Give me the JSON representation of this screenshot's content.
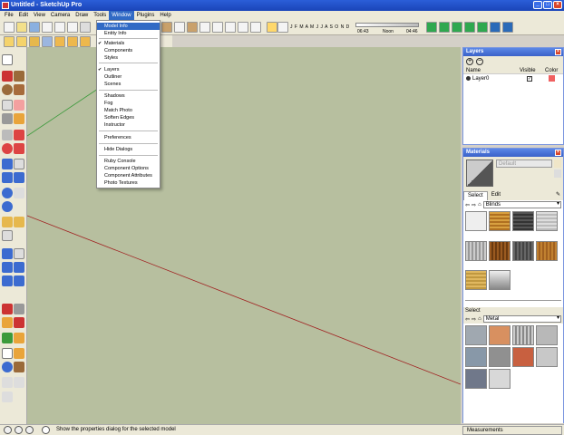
{
  "window": {
    "title": "Untitled - SketchUp Pro"
  },
  "menu": [
    "File",
    "Edit",
    "View",
    "Camera",
    "Draw",
    "Tools",
    "Window",
    "Plugins",
    "Help"
  ],
  "window_menu": {
    "items": [
      {
        "label": "Model Info",
        "selected": true
      },
      {
        "label": "Entity Info"
      },
      {
        "label": "Materials",
        "checked": true
      },
      {
        "label": "Components"
      },
      {
        "label": "Styles"
      },
      {
        "label": "Layers",
        "checked": true
      },
      {
        "label": "Outliner"
      },
      {
        "label": "Scenes"
      },
      {
        "label": "Shadows"
      },
      {
        "label": "Fog"
      },
      {
        "label": "Match Photo"
      },
      {
        "label": "Soften Edges"
      },
      {
        "label": "Instructor"
      },
      {
        "label": "Preferences"
      },
      {
        "label": "Hide Dialogs"
      },
      {
        "label": "Ruby Console"
      },
      {
        "label": "Component Options"
      },
      {
        "label": "Component Attributes"
      },
      {
        "label": "Photo Textures"
      }
    ]
  },
  "shadow_toolbar": {
    "months": "J F M A M J J A S O N D",
    "time_start": "06:43",
    "time_mid": "Noon",
    "time_end": "04:46"
  },
  "layers_panel": {
    "title": "Layers",
    "columns": [
      "Name",
      "Visible",
      "Color"
    ],
    "rows": [
      {
        "name": "Layer0",
        "visible": true,
        "color": "#f06060"
      }
    ]
  },
  "materials_panel": {
    "title": "Materials",
    "current_name": "Default",
    "tabs": [
      "Select",
      "Edit"
    ],
    "collection": "Blinds",
    "lower_label": "Select",
    "lower_collection": "Metal"
  },
  "status": {
    "text": "Show the properties dialog for the selected model",
    "measurements_label": "Measurements"
  },
  "colors": {
    "canvas": "#b7bf9f",
    "axis_red": "#a02020",
    "axis_green": "#3c9a3c",
    "title_blue": "#2b5ed8"
  }
}
